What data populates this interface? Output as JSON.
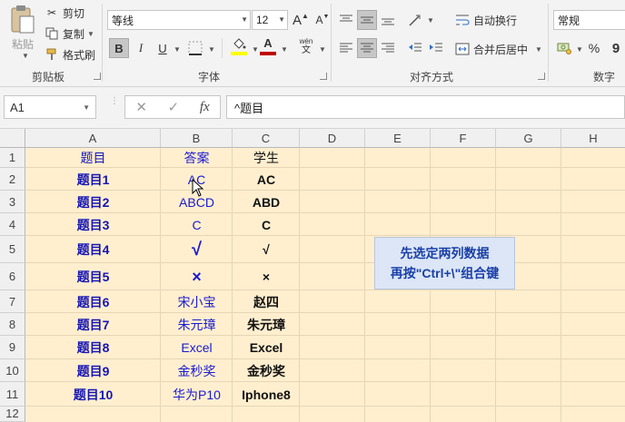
{
  "ribbon": {
    "clipboard": {
      "paste_label": "粘贴",
      "cut_label": "剪切",
      "copy_label": "复制",
      "format_painter_label": "格式刷",
      "group_label": "剪贴板"
    },
    "font": {
      "font_name": "等线",
      "font_size": "12",
      "grow_label": "A",
      "shrink_label": "A",
      "bold": "B",
      "italic": "I",
      "underline": "U",
      "font_color_letter": "A",
      "phonetic_top": "wén",
      "phonetic_bottom": "文",
      "group_label": "字体"
    },
    "alignment": {
      "wrap_text_label": "自动换行",
      "merge_center_label": "合并后居中",
      "group_label": "对齐方式"
    },
    "number": {
      "format": "常规",
      "percent": "%",
      "comma": "9",
      "group_label": "数字"
    }
  },
  "formula_bar": {
    "name_box": "A1",
    "cancel_glyph": "✕",
    "enter_glyph": "✓",
    "fx_label": "fx",
    "formula": "^题目"
  },
  "colors": {
    "sheet_fill": "#ffefcf",
    "note_fill": "#dce6f6",
    "col_a_text": "#1414b4",
    "col_b_text": "#1a1ad2",
    "font_color_bar": "#c00000",
    "fill_color_bar": "#ffff00"
  },
  "columns": [
    "A",
    "B",
    "C",
    "D",
    "E",
    "F",
    "G",
    "H"
  ],
  "rows": [
    "1",
    "2",
    "3",
    "4",
    "5",
    "6",
    "7",
    "8",
    "9",
    "10",
    "11",
    "12"
  ],
  "cells": [
    {
      "a": "题目",
      "b": "答案",
      "c": "学生"
    },
    {
      "a": "题目1",
      "b": "AC",
      "c": "AC"
    },
    {
      "a": "题目2",
      "b": "ABCD",
      "c": "ABD"
    },
    {
      "a": "题目3",
      "b": "C",
      "c": "C"
    },
    {
      "a": "题目4",
      "b": "√",
      "c": "√"
    },
    {
      "a": "题目5",
      "b": "×",
      "c": "×"
    },
    {
      "a": "题目6",
      "b": "宋小宝",
      "c": "赵四"
    },
    {
      "a": "题目7",
      "b": "朱元璋",
      "c": "朱元璋"
    },
    {
      "a": "题目8",
      "b": "Excel",
      "c": "Excel"
    },
    {
      "a": "题目9",
      "b": "金秒奖",
      "c": "金秒奖"
    },
    {
      "a": "题目10",
      "b": "华为P10",
      "c": "Iphone8"
    }
  ],
  "note": {
    "line1": "先选定两列数据",
    "line2": "再按\"Ctrl+\\\"组合键"
  }
}
